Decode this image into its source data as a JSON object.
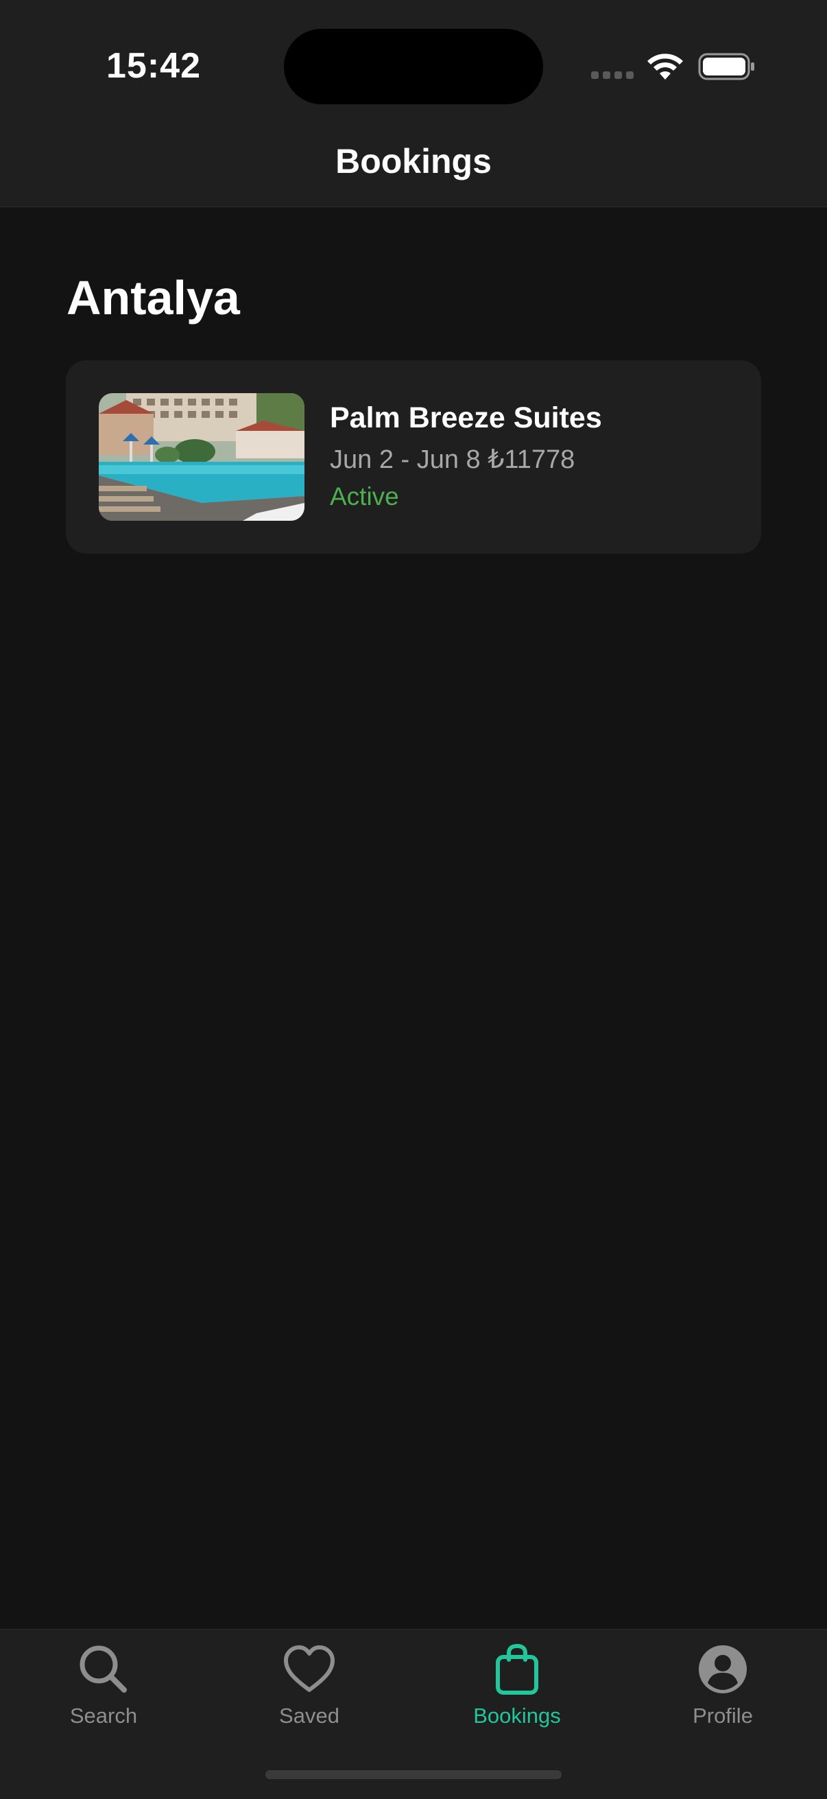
{
  "status_bar": {
    "time": "15:42"
  },
  "nav": {
    "title": "Bookings"
  },
  "section": {
    "title": "Antalya"
  },
  "bookings": [
    {
      "hotel_name": "Palm Breeze Suites",
      "dates_price": "Jun 2 - Jun 8 ₺11778",
      "status": "Active",
      "status_color": "#4caf50",
      "image": "hotel-pool-photo"
    }
  ],
  "tab_bar": {
    "accent_color": "#21c79b",
    "items": [
      {
        "label": "Search",
        "icon": "search-icon",
        "active": false
      },
      {
        "label": "Saved",
        "icon": "heart-icon",
        "active": false
      },
      {
        "label": "Bookings",
        "icon": "shopping-bag-icon",
        "active": true
      },
      {
        "label": "Profile",
        "icon": "person-circle-icon",
        "active": false
      }
    ]
  }
}
